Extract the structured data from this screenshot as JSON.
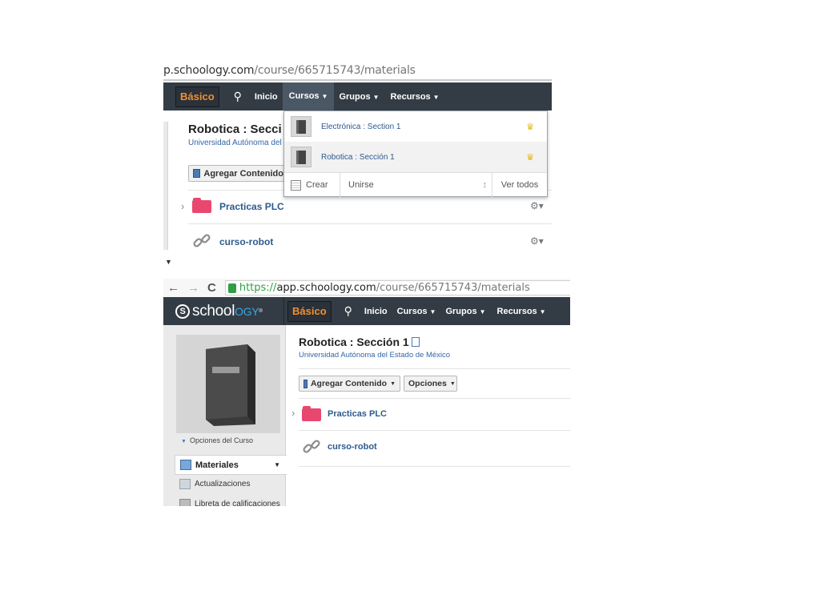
{
  "top": {
    "url": {
      "host": "p.schoology.com",
      "path": "/course/665715743/materials"
    },
    "nav": {
      "basico": "Básico",
      "search_icon": "search-icon",
      "inicio": "Inicio",
      "cursos": "Cursos",
      "grupos": "Grupos",
      "recursos": "Recursos",
      "caret": "▼"
    },
    "course": {
      "title": "Robotica : Secci",
      "subtitle": "Universidad Autónoma del"
    },
    "buttons": {
      "agregar": "Agregar Contenido"
    },
    "materials": [
      {
        "name": "Practicas PLC",
        "icon": "folder-icon"
      },
      {
        "name": "curso-robot",
        "icon": "link-icon"
      }
    ],
    "dropdown": {
      "courses": [
        {
          "name": "Electrónica : Section 1",
          "badge": "crown-icon"
        },
        {
          "name": "Robotica : Sección 1",
          "badge": "crown-icon"
        }
      ],
      "footer": {
        "crear": "Crear",
        "unirse": "Unirse",
        "ver_todos": "Ver todos"
      }
    }
  },
  "bottom": {
    "browser": {
      "back": "←",
      "forward": "→",
      "reload": "C",
      "https": "https://",
      "host": "app.schoology.com",
      "path": "/course/665715743/materials"
    },
    "logo": {
      "s": "S",
      "school": "school",
      "ogy": "OGY",
      "reg": "®"
    },
    "nav": {
      "basico": "Básico",
      "inicio": "Inicio",
      "cursos": "Cursos",
      "grupos": "Grupos",
      "recursos": "Recursos"
    },
    "course": {
      "title": "Robotica : Sección 1",
      "subtitle": "Universidad Autónoma del Estado de México"
    },
    "buttons": {
      "agregar": "Agregar Contenido",
      "opciones": "Opciones"
    },
    "materials": [
      {
        "name": "Practicas PLC",
        "icon": "folder-icon"
      },
      {
        "name": "curso-robot",
        "icon": "link-icon"
      }
    ],
    "sidebar": {
      "opciones_curso": "Opciones del Curso",
      "active": "Materiales",
      "items": [
        {
          "label": "Actualizaciones"
        },
        {
          "label": "Libreta de calificaciones"
        }
      ]
    }
  },
  "colors": {
    "navbar": "#333c45",
    "basico": "#f28f32",
    "link": "#2d5a8f",
    "folder": "#e8486e",
    "crown": "#e7b800"
  }
}
